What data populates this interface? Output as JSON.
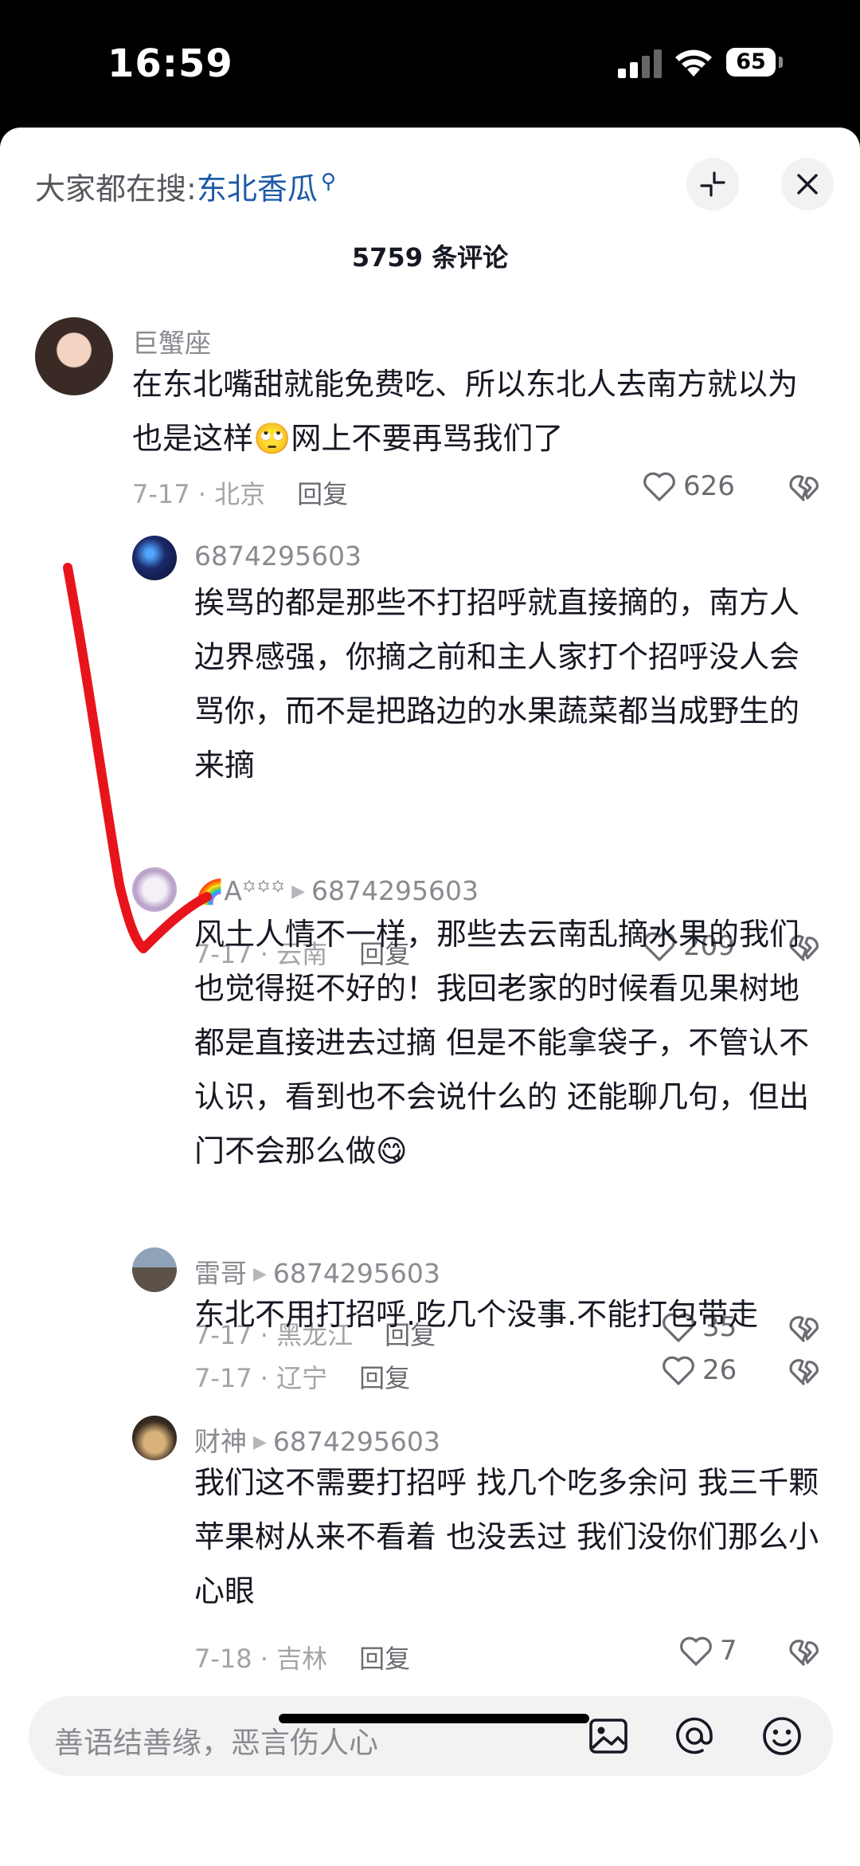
{
  "status_bar": {
    "time": "16:59",
    "battery": "65"
  },
  "header": {
    "search_prefix": "大家都在搜:",
    "search_keyword": "东北香瓜",
    "comment_count": "5759 条评论"
  },
  "comments": [
    {
      "user": "巨蟹座",
      "text": "在东北嘴甜就能免费吃、所以东北人去南方就以为也是这样🙄网上不要再骂我们了",
      "date_loc": "7-17 · 北京",
      "reply_label": "回复",
      "likes": "626"
    },
    {
      "user": "6874295603",
      "text": "挨骂的都是那些不打招呼就直接摘的，南方人边界感强，你摘之前和主人家打个招呼没人会骂你，而不是把路边的水果蔬菜都当成野生的来摘",
      "date_loc": "7-17 · 云南",
      "reply_label": "回复",
      "likes": "209"
    },
    {
      "user_emoji": "🌈",
      "user": "A꙳꙳꙳",
      "reply_to": "6874295603",
      "text": "风土人情不一样，那些去云南乱摘水果的我们也觉得挺不好的！我回老家的时候看见果树地都是直接进去过摘 但是不能拿袋子，不管认不认识，看到也不会说什么的 还能聊几句，但出门不会那么做😋",
      "date_loc": "7-17 · 黑龙江",
      "reply_label": "回复",
      "likes": "35"
    },
    {
      "user": "雷哥",
      "reply_to": "6874295603",
      "text": "东北不用打招呼.吃几个没事.不能打包带走",
      "date_loc": "7-17 · 辽宁",
      "reply_label": "回复",
      "likes": "26"
    },
    {
      "user": "财神",
      "reply_to": "6874295603",
      "text": "我们这不需要打招呼 找几个吃多余问 我三千颗苹果树从来不看着 也没丢过 我们没你们那么小心眼",
      "date_loc": "7-18 · 吉林",
      "reply_label": "回复",
      "likes": "7"
    }
  ],
  "input": {
    "placeholder": "善语结善缘，恶言伤人心"
  },
  "icons": {
    "collapse": "collapse-arrows-icon",
    "close": "close-icon",
    "like": "heart-icon",
    "dislike": "broken-heart-icon",
    "image": "image-icon",
    "mention": "at-icon",
    "emoji": "emoji-icon"
  },
  "colors": {
    "keyword": "#1c5aa8",
    "annotation": "#e8141c"
  }
}
